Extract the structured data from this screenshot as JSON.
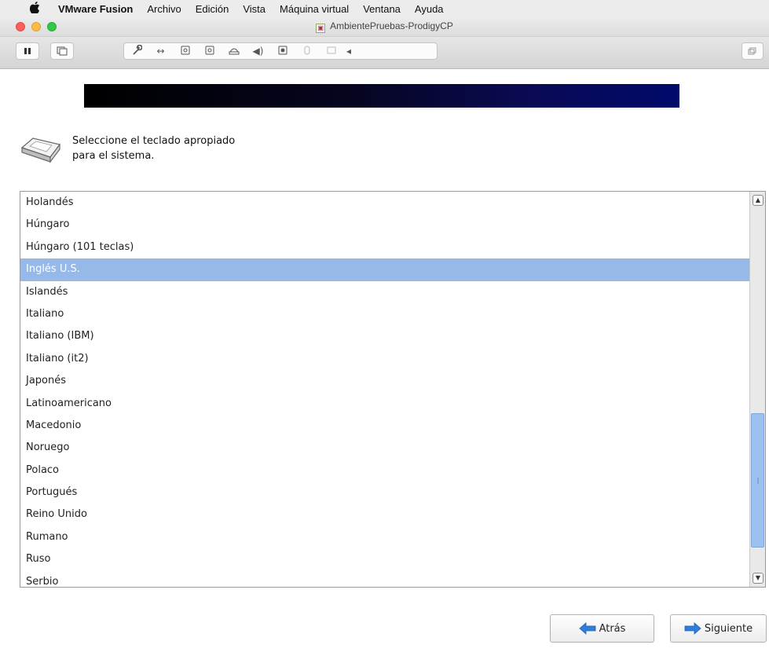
{
  "menubar": {
    "app_name": "VMware Fusion",
    "items": [
      "Archivo",
      "Edición",
      "Vista",
      "Máquina virtual",
      "Ventana",
      "Ayuda"
    ]
  },
  "window": {
    "title": "AmbientePruebas-ProdigyCP"
  },
  "installer": {
    "prompt_line1": "Seleccione el teclado apropiado",
    "prompt_line2": "para el sistema.",
    "keyboard_layouts": [
      "Holandés",
      "Húngaro",
      "Húngaro (101 teclas)",
      "Inglés U.S.",
      "Islandés",
      "Italiano",
      "Italiano (IBM)",
      "Italiano (it2)",
      "Japonés",
      "Latinoamericano",
      "Macedonio",
      "Noruego",
      "Polaco",
      "Portugués",
      "Reino Unido",
      "Rumano",
      "Ruso",
      "Serbio"
    ],
    "selected_index": 3,
    "scroll": {
      "thumb_start_fraction": 0.56,
      "thumb_end_fraction": 0.9
    },
    "back_label": "Atrás",
    "next_label": "Siguiente"
  },
  "colors": {
    "selection": "#97b9e8",
    "banner_end": "#000a6a",
    "arrow_blue": "#2f7fd9"
  }
}
